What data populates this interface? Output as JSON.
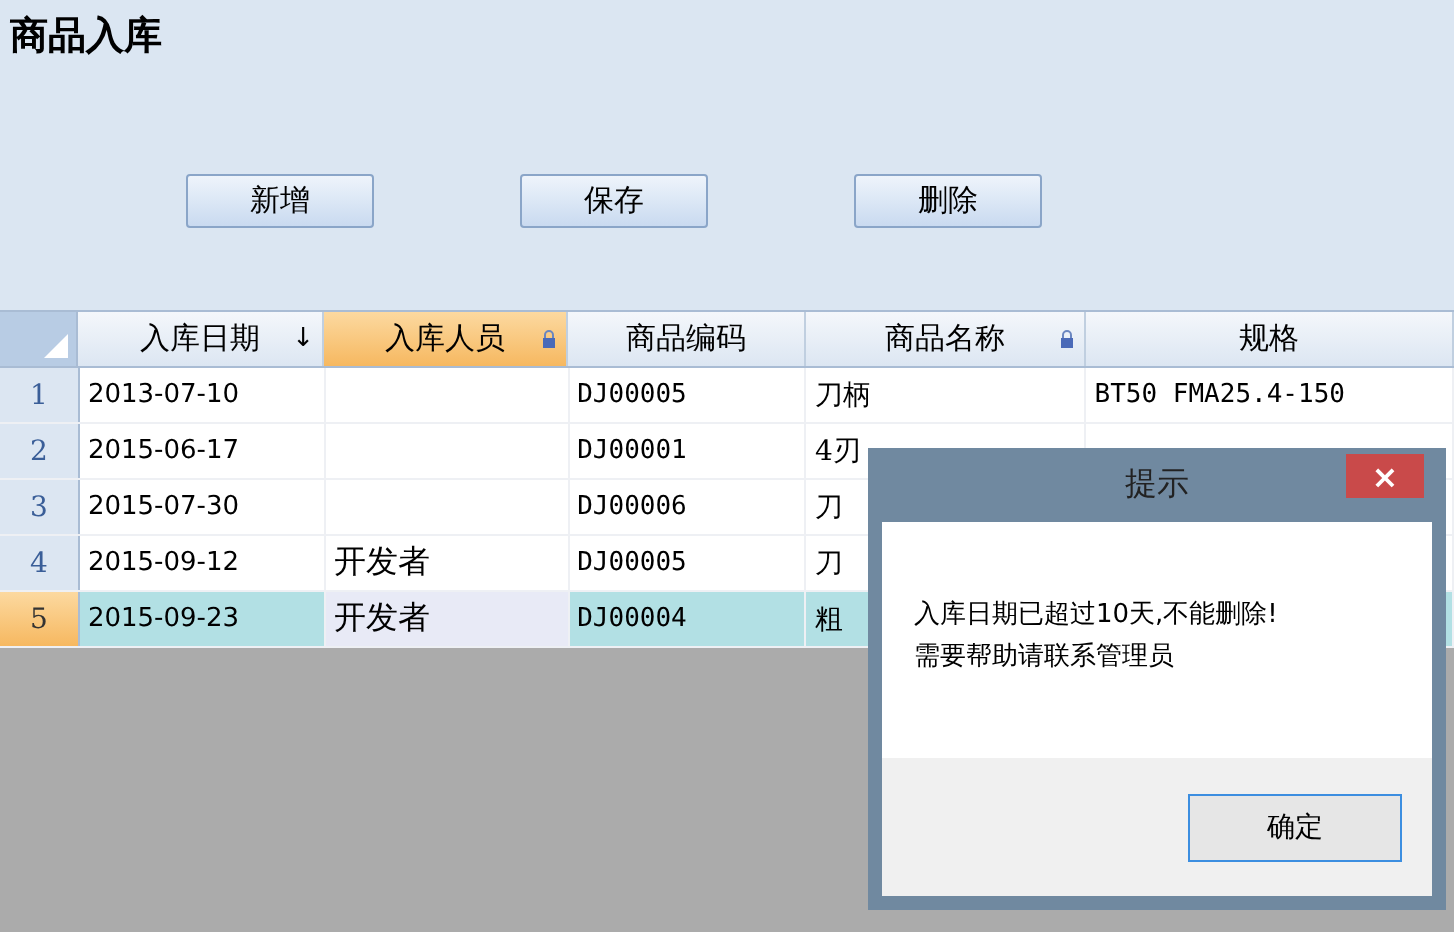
{
  "title": "商品入库",
  "buttons": [
    "新增",
    "保存",
    "删除"
  ],
  "columns": [
    {
      "label": "入库日期",
      "selected": false,
      "sort": "↓",
      "locked": false
    },
    {
      "label": "入库人员",
      "selected": true,
      "locked": true
    },
    {
      "label": "商品编码",
      "selected": false,
      "locked": false
    },
    {
      "label": "商品名称",
      "selected": false,
      "locked": true
    },
    {
      "label": "规格",
      "selected": false,
      "locked": false
    }
  ],
  "rows": [
    {
      "num": "1",
      "selected": false,
      "cells": [
        "2013-07-10",
        "",
        "DJ00005",
        "刀柄",
        "BT50 FMA25.4-150"
      ]
    },
    {
      "num": "2",
      "selected": false,
      "cells": [
        "2015-06-17",
        "",
        "DJ00001",
        "4刃",
        ""
      ]
    },
    {
      "num": "3",
      "selected": false,
      "cells": [
        "2015-07-30",
        "",
        "DJ00006",
        "刀",
        ""
      ]
    },
    {
      "num": "4",
      "selected": false,
      "cells": [
        "2015-09-12",
        "开发者",
        "DJ00005",
        "刀",
        ""
      ]
    },
    {
      "num": "5",
      "selected": true,
      "cells": [
        "2015-09-23",
        "开发者",
        "DJ00004",
        "粗",
        ""
      ]
    }
  ],
  "dialog": {
    "title": "提示",
    "close": "×",
    "lines": [
      "入库日期已超过10天,不能删除!",
      "需要帮助请联系管理员"
    ],
    "button": "确定"
  }
}
